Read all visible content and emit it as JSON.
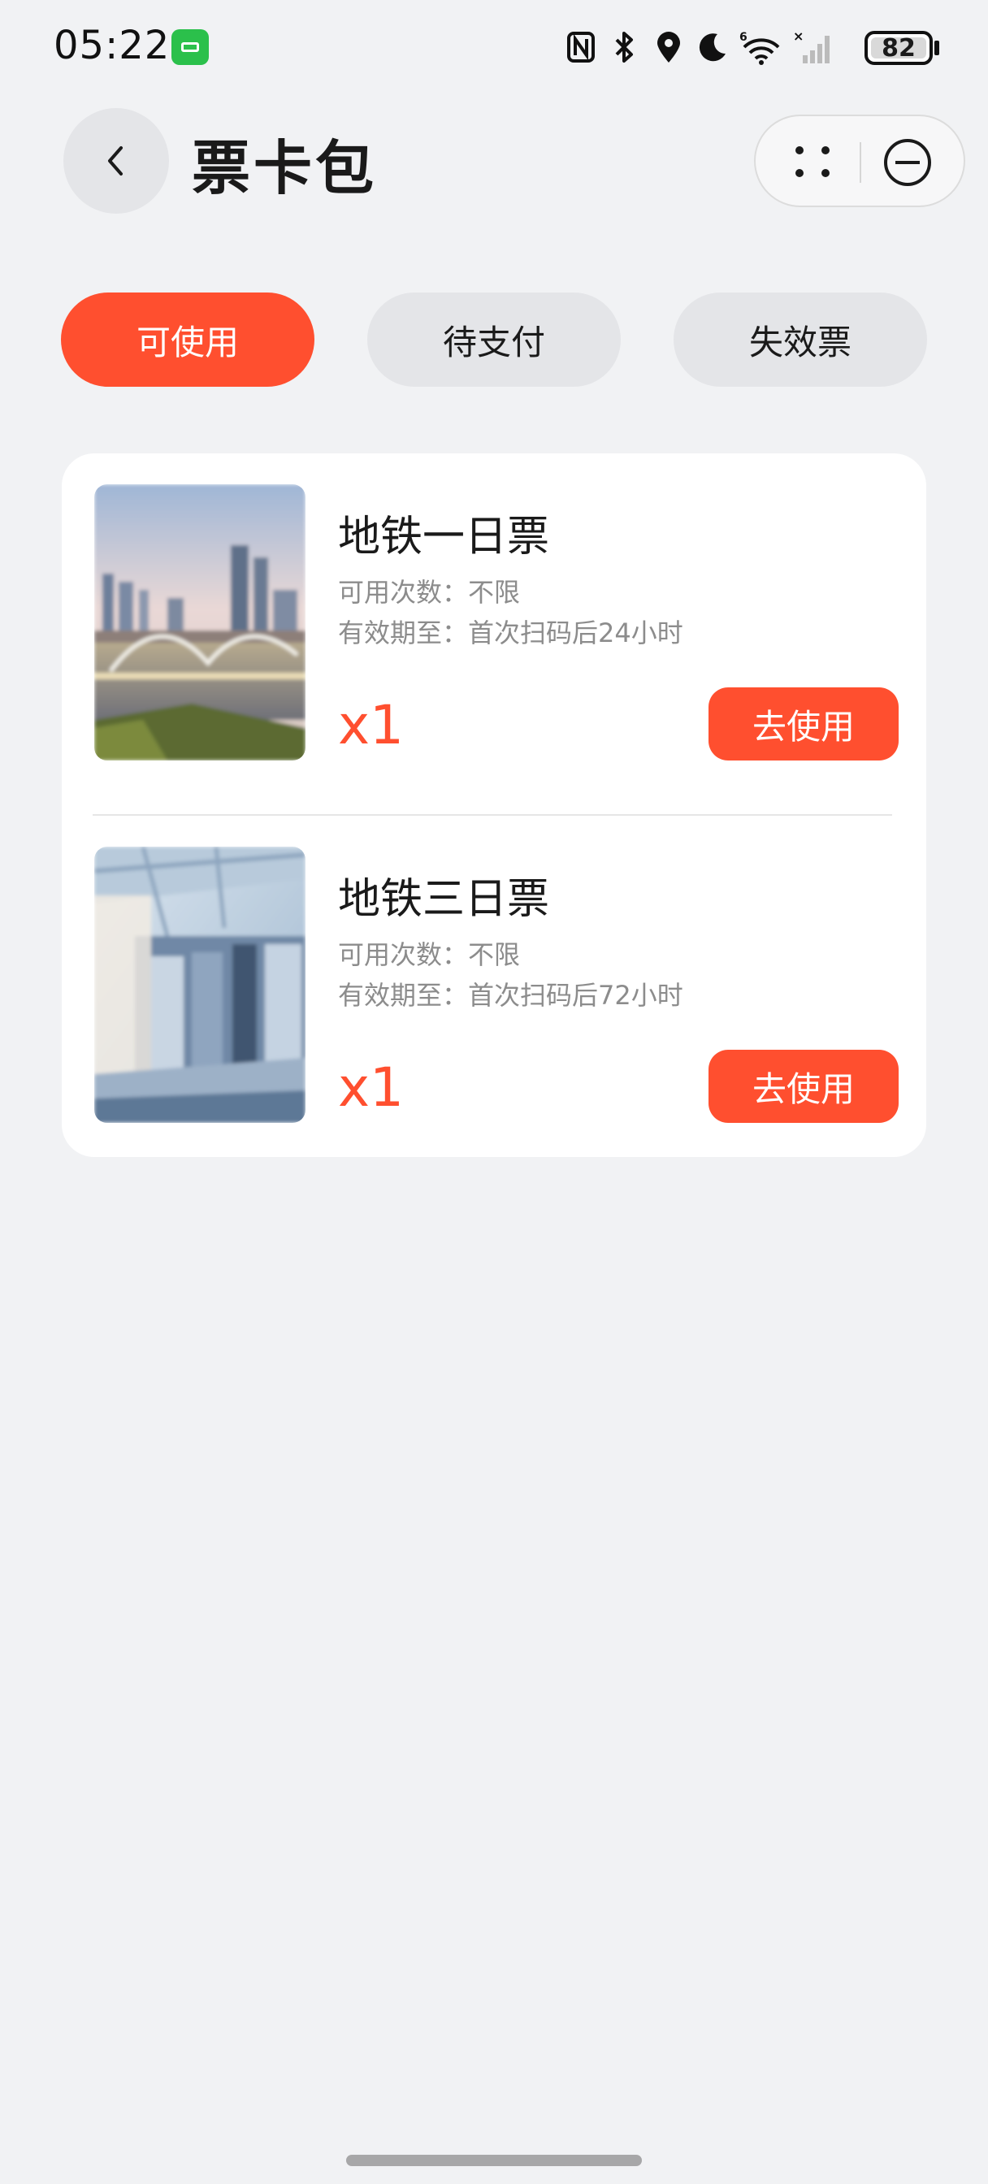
{
  "status_bar": {
    "time": "05:22",
    "battery": "82",
    "icons": [
      "notification-app-icon",
      "nfc-icon",
      "bluetooth-icon",
      "location-icon",
      "moon-icon",
      "wifi-6-icon",
      "signal-icon",
      "battery-icon"
    ]
  },
  "header": {
    "title": "票卡包",
    "back_icon": "chevron-left-icon",
    "more_icon": "dots-icon",
    "close_icon": "minus-circle-icon"
  },
  "tabs": [
    {
      "label": "可使用",
      "active": true
    },
    {
      "label": "待支付",
      "active": false
    },
    {
      "label": "失效票",
      "active": false
    }
  ],
  "tickets": [
    {
      "name": "地铁一日票",
      "uses": "可用次数：不限",
      "validity": "有效期至：首次扫码后24小时",
      "quantity": "x1",
      "button": "去使用",
      "image": "city-skyline-bridge-photo"
    },
    {
      "name": "地铁三日票",
      "uses": "可用次数：不限",
      "validity": "有效期至：首次扫码后72小时",
      "quantity": "x1",
      "button": "去使用",
      "image": "subway-platform-photo"
    }
  ],
  "colors": {
    "accent": "#ff4f2f",
    "background": "#f1f2f4",
    "card": "#ffffff",
    "muted_text": "#8c8c8c"
  }
}
